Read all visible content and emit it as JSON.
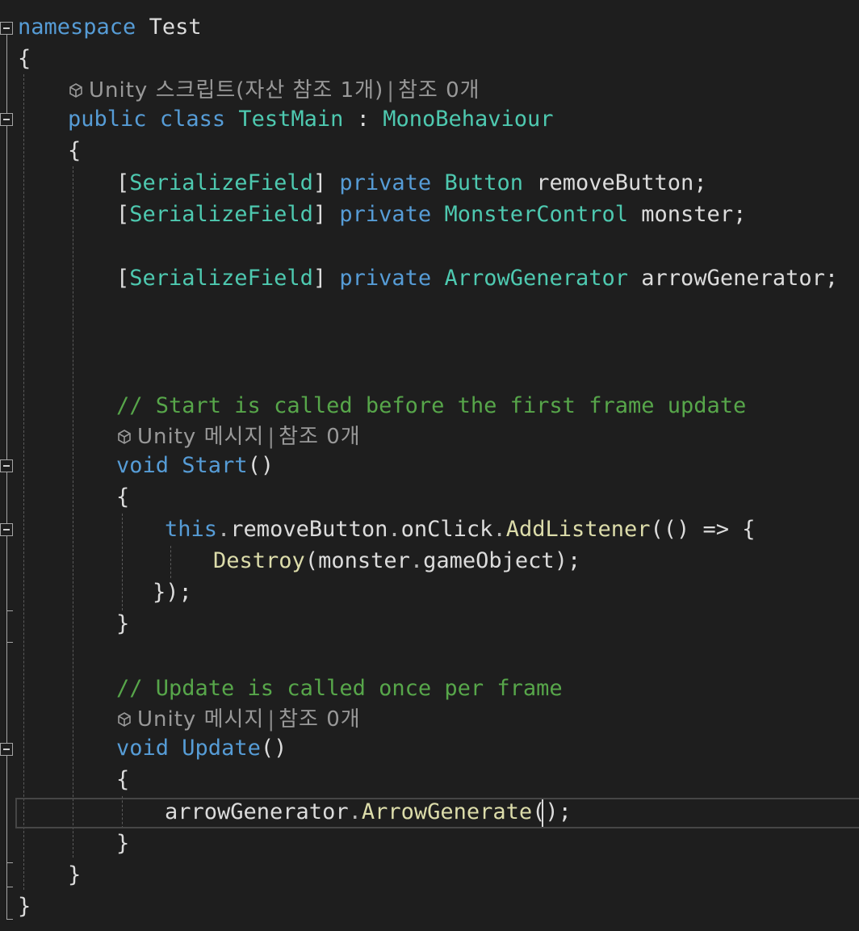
{
  "editor": {
    "lines": {
      "l1": {
        "kw": "namespace",
        "name": "Test"
      },
      "l2": {
        "brace": "{"
      },
      "l3": {
        "lens_a": "Unity 스크립트(자산 참조 1개)",
        "sep": "|",
        "lens_b": "참조 0개"
      },
      "l4": {
        "kw1": "public",
        "kw2": "class",
        "name": "TestMain",
        "colon": ":",
        "base": "MonoBehaviour"
      },
      "l5": {
        "brace": "{"
      },
      "l6": {
        "attr": "SerializeField",
        "kw": "private",
        "type": "Button",
        "name": "removeButton"
      },
      "l7": {
        "attr": "SerializeField",
        "kw": "private",
        "type": "MonsterControl",
        "name": "monster"
      },
      "l9": {
        "attr": "SerializeField",
        "kw": "private",
        "type": "ArrowGenerator",
        "name": "arrowGenerator"
      },
      "l13": {
        "comment": "// Start is called before the first frame update"
      },
      "l14": {
        "lens_a": "Unity 메시지",
        "sep": "|",
        "lens_b": "참조 0개"
      },
      "l15": {
        "kw": "void",
        "fn": "Start",
        "parens": "()"
      },
      "l16": {
        "brace": "{"
      },
      "l17": {
        "kw": "this",
        "dot1": ".",
        "member1": "removeButton",
        "dot2": ".",
        "member2": "onClick",
        "dot3": ".",
        "fn": "AddListener",
        "rest": "(() => {"
      },
      "l18": {
        "fn": "Destroy",
        "open": "(",
        "arg": "monster",
        "dot": ".",
        "member": "gameObject",
        "close": ");"
      },
      "l19": {
        "text": "});"
      },
      "l20": {
        "brace": "}"
      },
      "l22": {
        "comment": "// Update is called once per frame"
      },
      "l23": {
        "lens_a": "Unity 메시지",
        "sep": "|",
        "lens_b": "참조 0개"
      },
      "l24": {
        "kw": "void",
        "fn": "Update",
        "parens": "()"
      },
      "l25": {
        "brace": "{"
      },
      "l26": {
        "obj": "arrowGenerator",
        "dot": ".",
        "fn": "ArrowGenerate",
        "rest": "();"
      },
      "l27": {
        "brace": "}"
      },
      "l28": {
        "brace": "}"
      },
      "l29": {
        "brace": "}"
      }
    },
    "icons": {
      "codelens": "unity-cube-icon",
      "fold": "collapse-minus-icon"
    },
    "colors": {
      "background": "#1e1e1e",
      "keyword": "#569cd6",
      "type": "#4ec9b0",
      "method": "#dcdcaa",
      "comment": "#57a64a",
      "identifier": "#dcdcdc",
      "codelens": "#999999"
    }
  }
}
